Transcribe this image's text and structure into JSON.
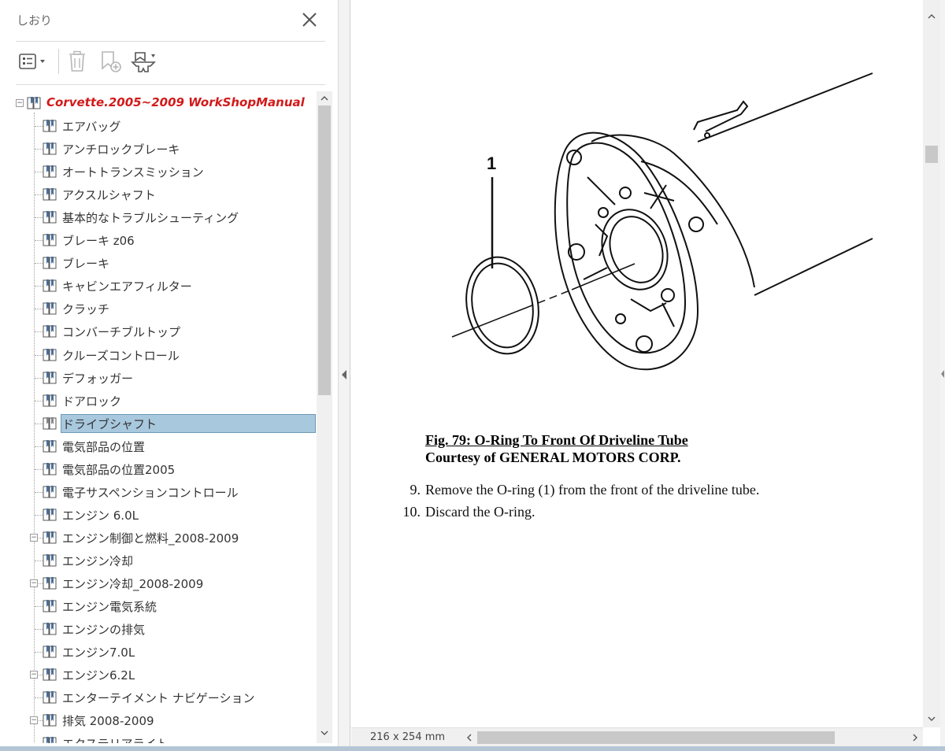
{
  "panel": {
    "title": "しおり",
    "root_label": "Corvette.2005~2009 WorkShopManual",
    "items": [
      {
        "label": "エアバッグ",
        "expandable": false
      },
      {
        "label": "アンチロックブレーキ",
        "expandable": false
      },
      {
        "label": "オートトランスミッション",
        "expandable": false
      },
      {
        "label": "アクスルシャフト",
        "expandable": false
      },
      {
        "label": "基本的なトラブルシューティング",
        "expandable": false
      },
      {
        "label": "ブレーキ z06",
        "expandable": false
      },
      {
        "label": "ブレーキ",
        "expandable": false
      },
      {
        "label": "キャビンエアフィルター",
        "expandable": false
      },
      {
        "label": "クラッチ",
        "expandable": false
      },
      {
        "label": "コンバーチブルトップ",
        "expandable": false
      },
      {
        "label": "クルーズコントロール",
        "expandable": false
      },
      {
        "label": "デフォッガー",
        "expandable": false
      },
      {
        "label": "ドアロック",
        "expandable": false
      },
      {
        "label": "ドライブシャフト",
        "expandable": false,
        "selected": true
      },
      {
        "label": "電気部品の位置",
        "expandable": false
      },
      {
        "label": "電気部品の位置2005",
        "expandable": false
      },
      {
        "label": "電子サスペンションコントロール",
        "expandable": false
      },
      {
        "label": "エンジン 6.0L",
        "expandable": false
      },
      {
        "label": "エンジン制御と燃料_2008-2009",
        "expandable": true
      },
      {
        "label": "エンジン冷却",
        "expandable": false
      },
      {
        "label": "エンジン冷却_2008-2009",
        "expandable": true
      },
      {
        "label": "エンジン電気系統",
        "expandable": false
      },
      {
        "label": "エンジンの排気",
        "expandable": false
      },
      {
        "label": "エンジン7.0L",
        "expandable": false
      },
      {
        "label": "エンジン6.2L",
        "expandable": true
      },
      {
        "label": "エンターテイメント  ナビゲーション",
        "expandable": false
      },
      {
        "label": "排気   2008-2009",
        "expandable": true
      },
      {
        "label": "エクステリアライト",
        "expandable": false
      }
    ]
  },
  "document": {
    "figure_callout": "1",
    "caption_title": "Fig. 79: O-Ring To Front Of Driveline Tube",
    "caption_credit": "Courtesy of GENERAL MOTORS CORP.",
    "steps": [
      {
        "num": "9.",
        "text": "Remove the O-ring (1) from the front of the driveline tube."
      },
      {
        "num": "10.",
        "text": "Discard the O-ring."
      }
    ]
  },
  "status": {
    "page_size": "216 x 254 mm"
  },
  "icons": {
    "close": "close-icon",
    "options": "bookmark-options-icon",
    "delete": "trash-icon",
    "new_bookmark": "new-bookmark-icon",
    "expand_bookmark": "find-current-bookmark-icon"
  },
  "colors": {
    "root_label": "#d21a1a",
    "selected_bg": "#a8c8de",
    "selected_border": "#6e9ab8"
  }
}
